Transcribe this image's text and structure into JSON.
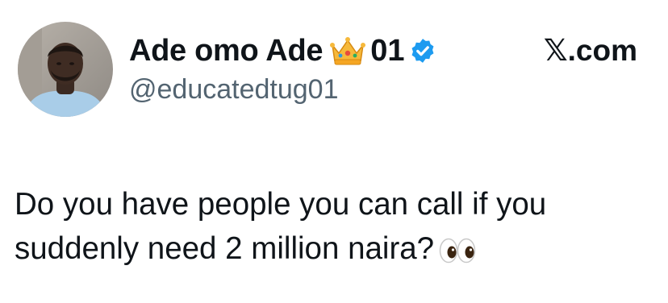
{
  "author": {
    "display_name": "Ade omo Ade",
    "name_suffix": "01",
    "handle": "@educatedtug01",
    "name_icon": "crown-icon",
    "verified_icon": "verified-badge-icon",
    "verified_color": "#1d9bf0"
  },
  "source": {
    "label": "𝕏.com"
  },
  "tweet": {
    "text": "Do you have people you can call if you suddenly need 2 million naira?",
    "trailing_icon": "eyes-emoji-icon"
  },
  "colors": {
    "text": "#0f1419",
    "handle": "#536471",
    "background": "#ffffff"
  }
}
